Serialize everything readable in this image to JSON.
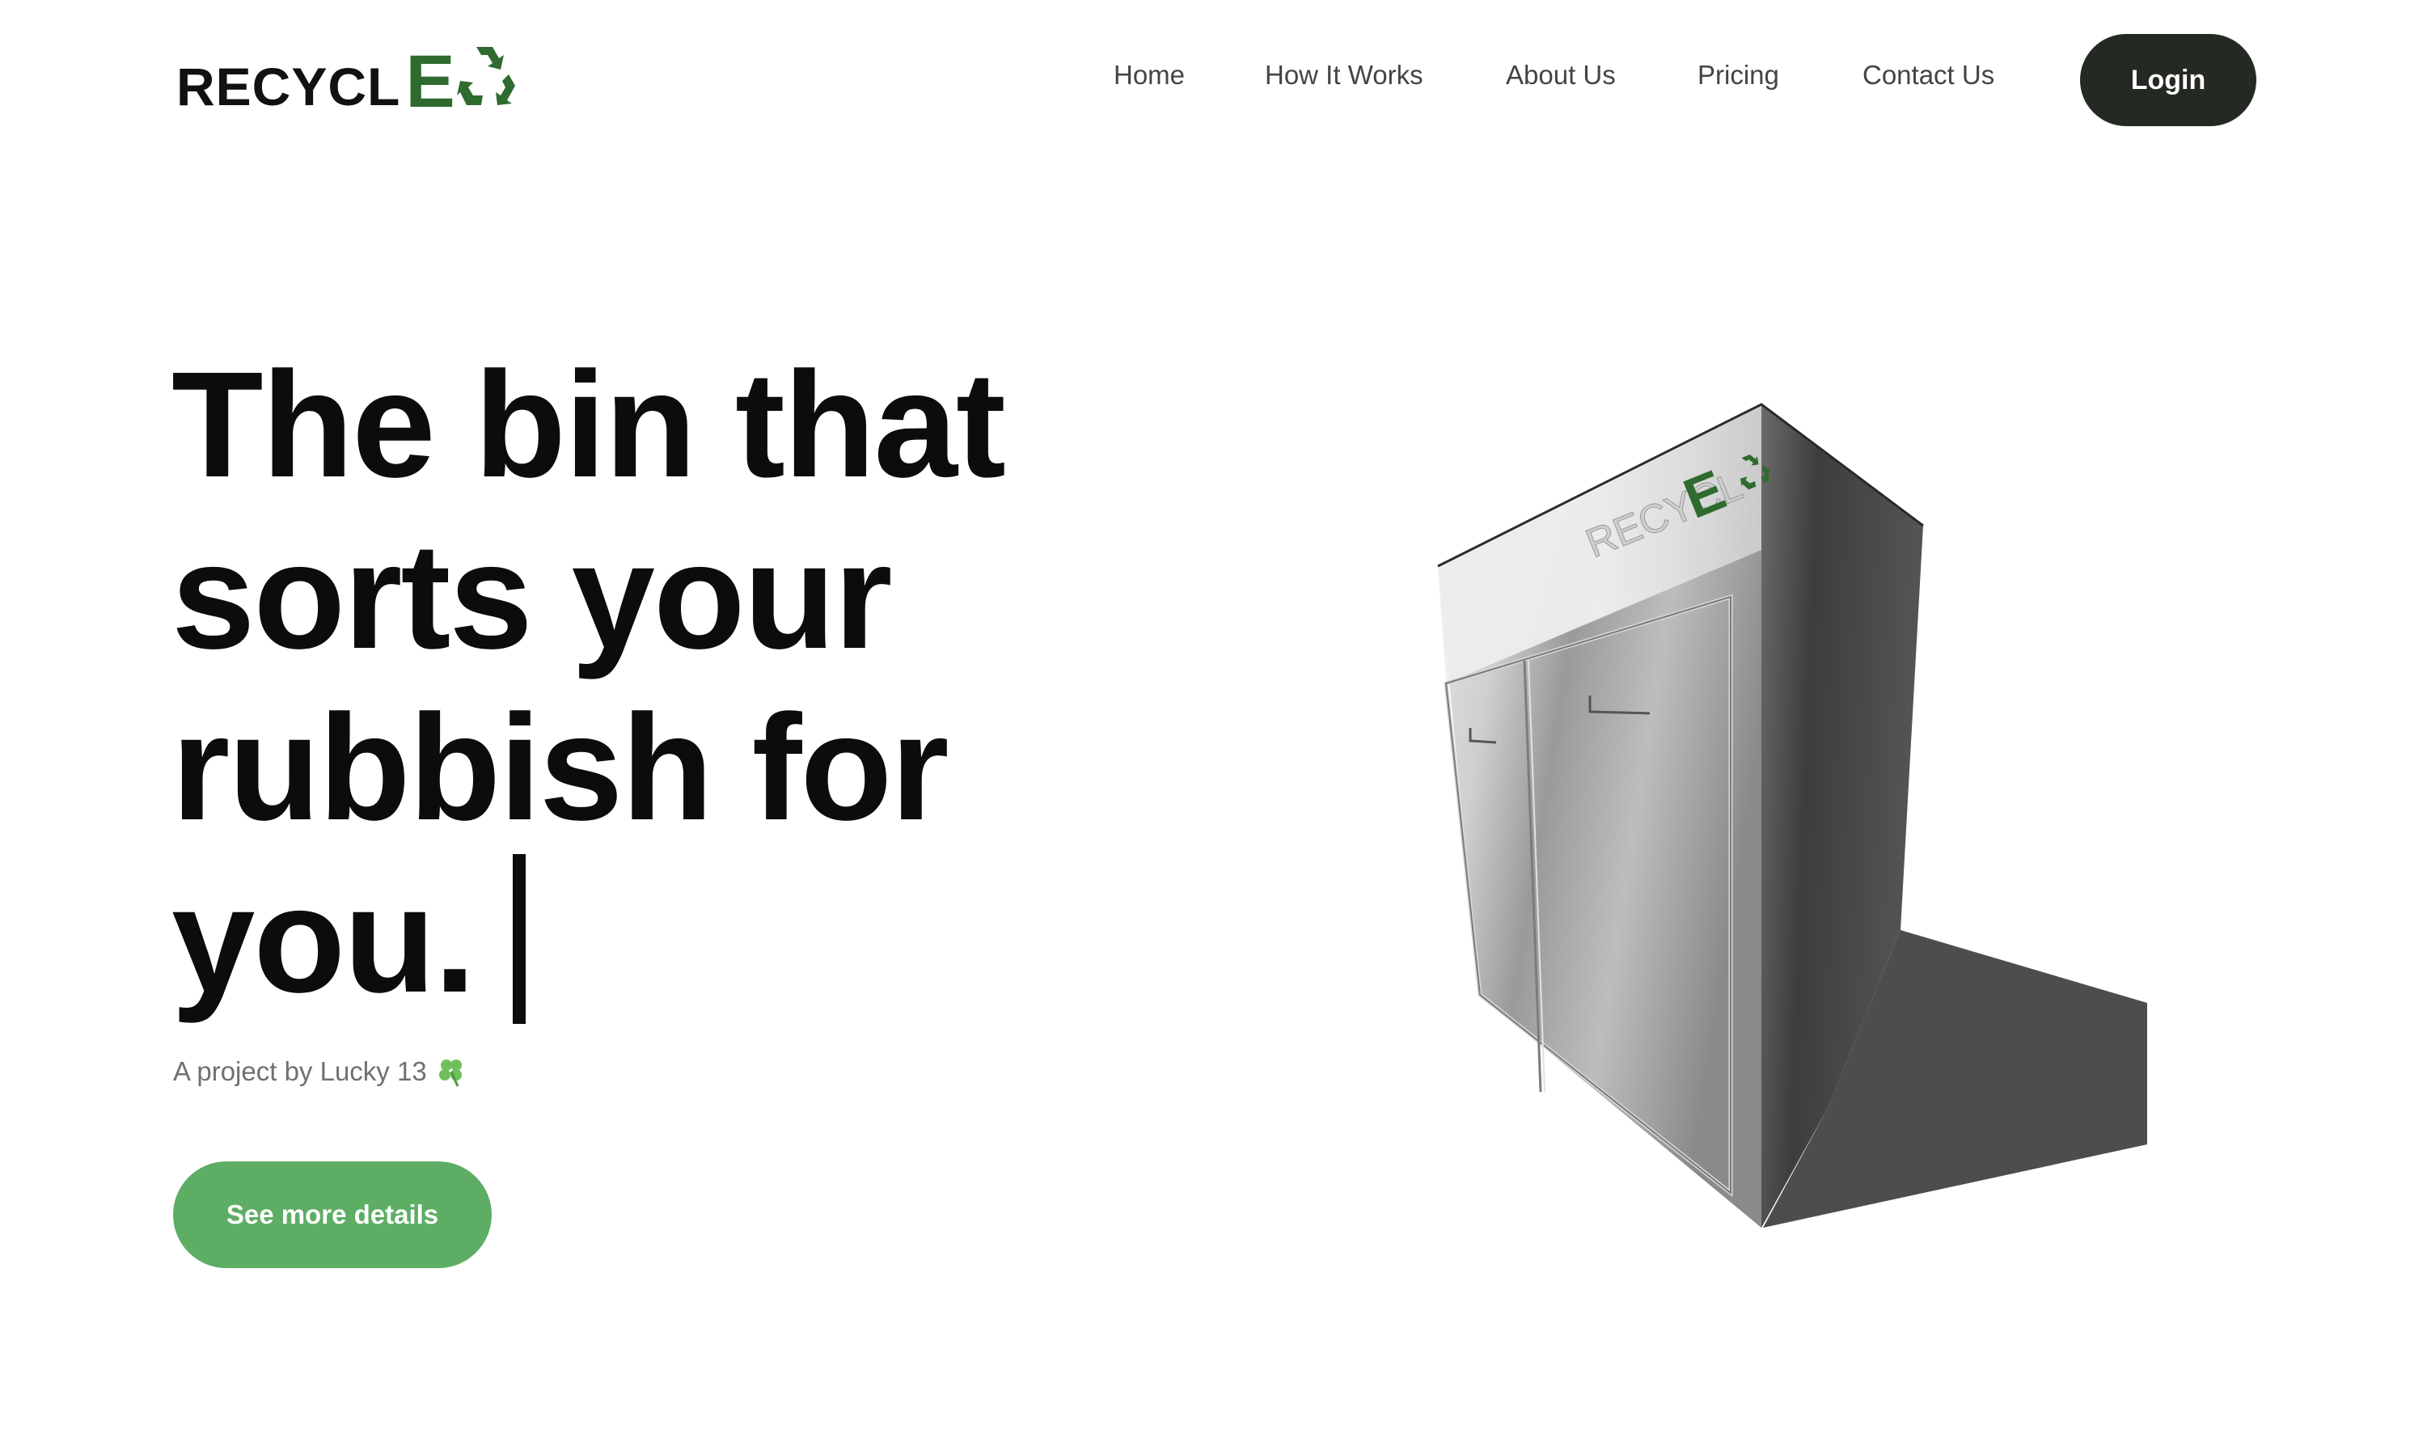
{
  "brand": {
    "logo_text": "RECYCL",
    "logo_e": "E",
    "logo_icon": "recycle-icon",
    "accent_color": "#2f6b2f"
  },
  "nav": {
    "items": [
      {
        "label": "Home"
      },
      {
        "label": "How It Works"
      },
      {
        "label": "About Us"
      },
      {
        "label": "Pricing"
      },
      {
        "label": "Contact Us"
      }
    ],
    "login_label": "Login",
    "login_color": "#252923"
  },
  "hero": {
    "title_lines": [
      "The bin that",
      "sorts your",
      "rubbish for",
      "you."
    ],
    "subtitle": "A project by Lucky 13",
    "subtitle_icon": "clover-icon",
    "cta_label": "See more details",
    "cta_color": "#5ead64"
  },
  "product": {
    "image": "stainless-steel-smart-bin",
    "bin_logo_text": "RECYCL",
    "bin_logo_e": "E"
  }
}
